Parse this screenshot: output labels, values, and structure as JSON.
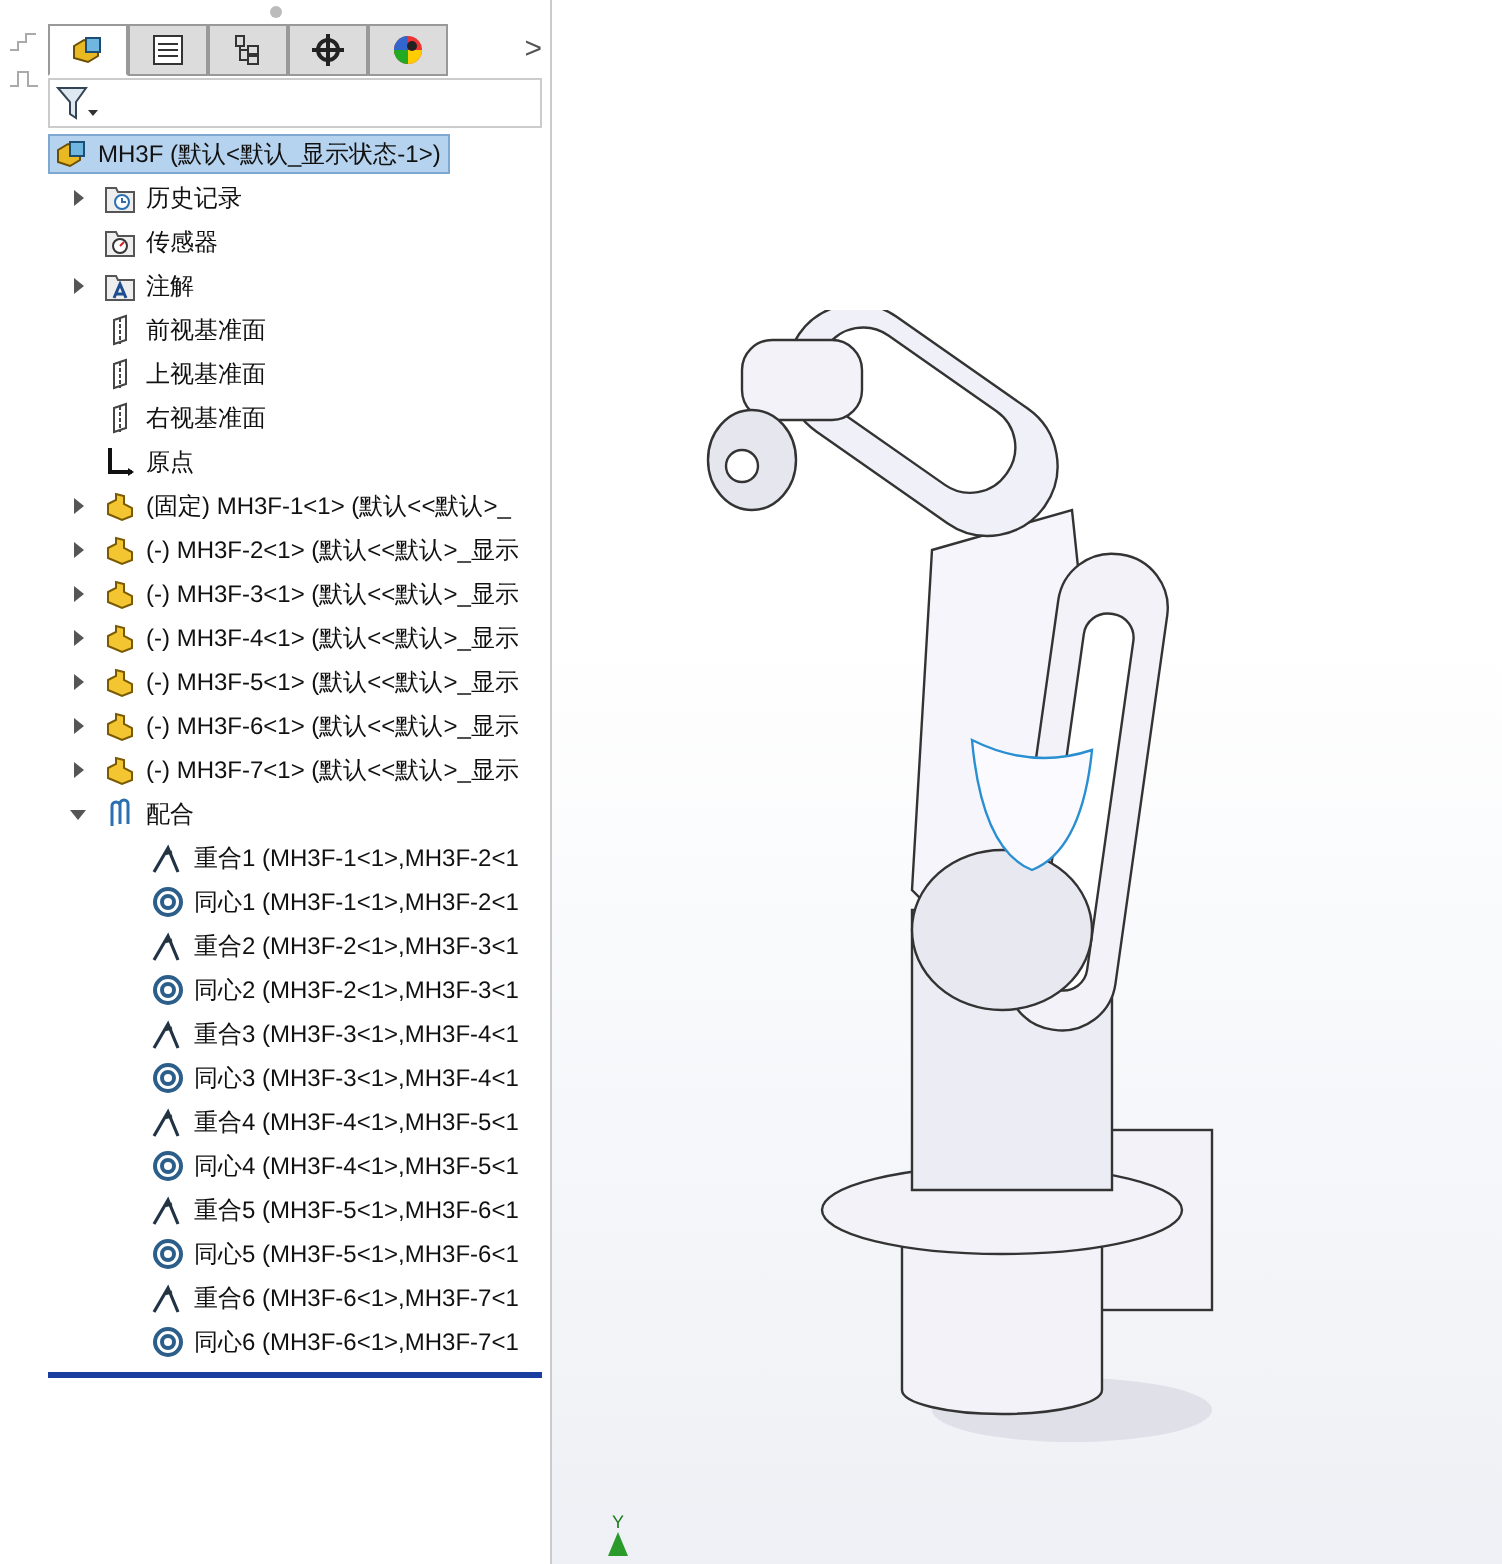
{
  "tabs": [
    {
      "kind": "feature",
      "selected": true
    },
    {
      "kind": "property",
      "selected": false
    },
    {
      "kind": "config",
      "selected": false
    },
    {
      "kind": "dim",
      "selected": false
    },
    {
      "kind": "display",
      "selected": false
    }
  ],
  "tabs_more": ">",
  "tree": {
    "label": "MH3F  (默认<默认_显示状态-1>)",
    "kind": "assembly",
    "selected": true,
    "children": [
      {
        "label": "历史记录",
        "kind": "history",
        "expanded": false,
        "selected": false
      },
      {
        "label": "传感器",
        "kind": "sensor",
        "selected": false
      },
      {
        "label": "注解",
        "kind": "annotation",
        "expanded": false,
        "selected": false
      },
      {
        "label": "前视基准面",
        "kind": "plane",
        "selected": false
      },
      {
        "label": "上视基准面",
        "kind": "plane",
        "selected": false
      },
      {
        "label": "右视基准面",
        "kind": "plane",
        "selected": false
      },
      {
        "label": "原点",
        "kind": "origin",
        "selected": false
      },
      {
        "label": "(固定) MH3F-1<1> (默认<<默认>_",
        "kind": "part",
        "expanded": false,
        "selected": false
      },
      {
        "label": "(-) MH3F-2<1> (默认<<默认>_显示",
        "kind": "part",
        "expanded": false,
        "selected": false
      },
      {
        "label": "(-) MH3F-3<1> (默认<<默认>_显示",
        "kind": "part",
        "expanded": false,
        "selected": false
      },
      {
        "label": "(-) MH3F-4<1> (默认<<默认>_显示",
        "kind": "part",
        "expanded": false,
        "selected": false
      },
      {
        "label": "(-) MH3F-5<1> (默认<<默认>_显示",
        "kind": "part",
        "expanded": false,
        "selected": false
      },
      {
        "label": "(-) MH3F-6<1> (默认<<默认>_显示",
        "kind": "part",
        "expanded": false,
        "selected": false
      },
      {
        "label": "(-) MH3F-7<1> (默认<<默认>_显示",
        "kind": "part",
        "expanded": false,
        "selected": false
      },
      {
        "label": "配合",
        "kind": "mates",
        "expanded": true,
        "selected": false,
        "children": [
          {
            "label": "重合1 (MH3F-1<1>,MH3F-2<1",
            "kind": "coincident",
            "selected": false
          },
          {
            "label": "同心1 (MH3F-1<1>,MH3F-2<1",
            "kind": "concentric",
            "selected": false
          },
          {
            "label": "重合2 (MH3F-2<1>,MH3F-3<1",
            "kind": "coincident",
            "selected": false
          },
          {
            "label": "同心2 (MH3F-2<1>,MH3F-3<1",
            "kind": "concentric",
            "selected": false
          },
          {
            "label": "重合3 (MH3F-3<1>,MH3F-4<1",
            "kind": "coincident",
            "selected": false
          },
          {
            "label": "同心3 (MH3F-3<1>,MH3F-4<1",
            "kind": "concentric",
            "selected": false
          },
          {
            "label": "重合4 (MH3F-4<1>,MH3F-5<1",
            "kind": "coincident",
            "selected": false
          },
          {
            "label": "同心4 (MH3F-4<1>,MH3F-5<1",
            "kind": "concentric",
            "selected": false
          },
          {
            "label": "重合5 (MH3F-5<1>,MH3F-6<1",
            "kind": "coincident",
            "selected": false
          },
          {
            "label": "同心5 (MH3F-5<1>,MH3F-6<1",
            "kind": "concentric",
            "selected": false
          },
          {
            "label": "重合6 (MH3F-6<1>,MH3F-7<1",
            "kind": "coincident",
            "selected": false
          },
          {
            "label": "同心6 (MH3F-6<1>,MH3F-7<1",
            "kind": "concentric",
            "selected": false
          }
        ]
      }
    ]
  },
  "triad": {
    "axis_label": "Y"
  }
}
